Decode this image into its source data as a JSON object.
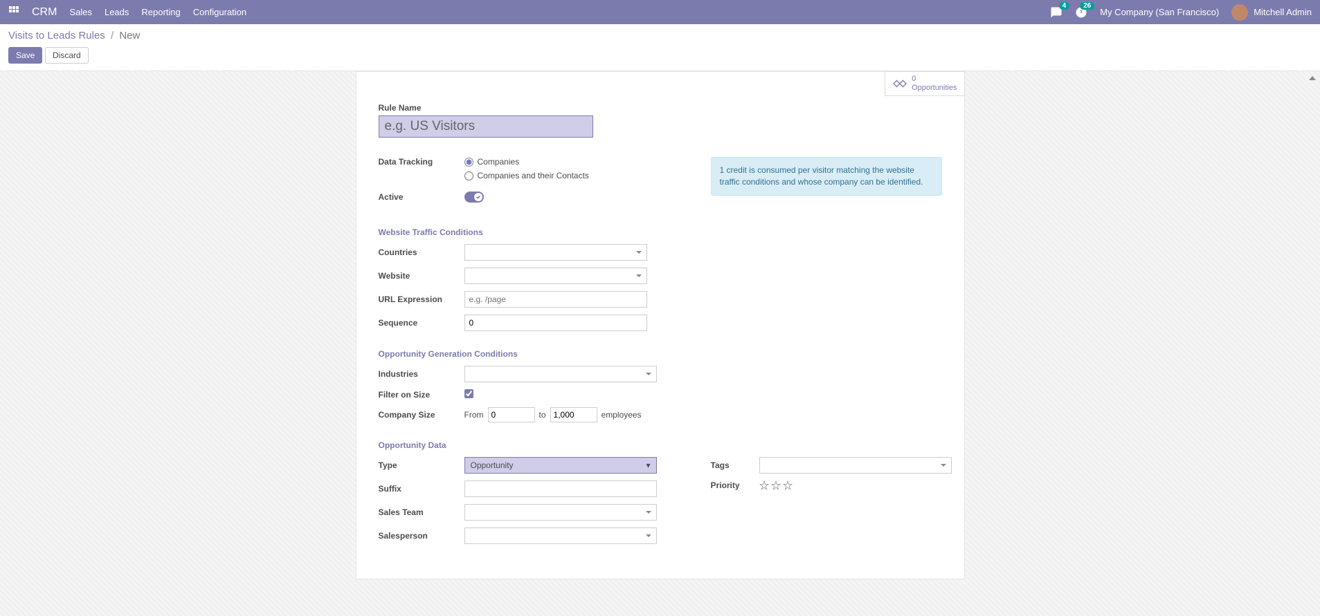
{
  "header": {
    "app_title": "CRM",
    "nav": [
      "Sales",
      "Leads",
      "Reporting",
      "Configuration"
    ],
    "messages_badge": "4",
    "activities_badge": "26",
    "company": "My Company (San Francisco)",
    "user": "Mitchell Admin"
  },
  "breadcrumb": {
    "parent": "Visits to Leads Rules",
    "current": "New"
  },
  "buttons": {
    "save": "Save",
    "discard": "Discard"
  },
  "stat": {
    "count": "0",
    "label": "Opportunities"
  },
  "form": {
    "rule_name_label": "Rule Name",
    "rule_name_placeholder": "e.g. US Visitors",
    "data_tracking_label": "Data Tracking",
    "dt_opt1": "Companies",
    "dt_opt2": "Companies and their Contacts",
    "active_label": "Active",
    "info_text": "1 credit is consumed per visitor matching the website traffic conditions and whose company can be identified.",
    "section_traffic": "Website Traffic Conditions",
    "countries_label": "Countries",
    "website_label": "Website",
    "url_label": "URL Expression",
    "url_placeholder": "e.g. /page",
    "sequence_label": "Sequence",
    "sequence_value": "0",
    "section_oppgen": "Opportunity Generation Conditions",
    "industries_label": "Industries",
    "filter_size_label": "Filter on Size",
    "company_size_label": "Company Size",
    "from_text": "From",
    "from_value": "0",
    "to_text": "to",
    "to_value": "1,000",
    "employees_text": "employees",
    "section_oppdata": "Opportunity Data",
    "type_label": "Type",
    "type_value": "Opportunity",
    "suffix_label": "Suffix",
    "salesteam_label": "Sales Team",
    "salesperson_label": "Salesperson",
    "tags_label": "Tags",
    "priority_label": "Priority"
  }
}
